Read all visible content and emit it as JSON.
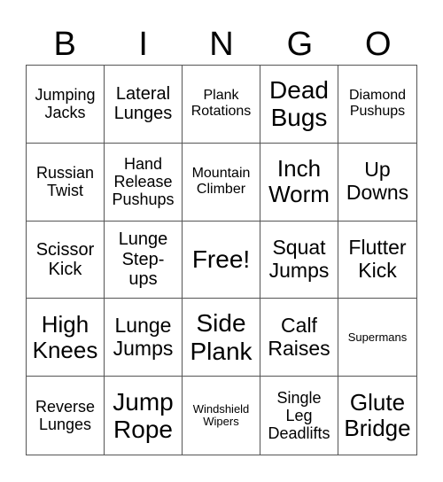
{
  "header": [
    "B",
    "I",
    "N",
    "G",
    "O"
  ],
  "cells": [
    "Jumping\nJacks",
    "Lateral\nLunges",
    "Plank\nRotations",
    "Dead\nBugs",
    "Diamond\nPushups",
    "Russian\nTwist",
    "Hand\nRelease\nPushups",
    "Mountain\nClimber",
    "Inch\nWorm",
    "Up\nDowns",
    "Scissor\nKick",
    "Lunge\nStep-\nups",
    "Free!",
    "Squat\nJumps",
    "Flutter\nKick",
    "High\nKnees",
    "Lunge\nJumps",
    "Side\nPlank",
    "Calf\nRaises",
    "Supermans",
    "Reverse\nLunges",
    "Jump\nRope",
    "Windshield\nWipers",
    "Single\nLeg\nDeadlifts",
    "Glute\nBridge"
  ]
}
